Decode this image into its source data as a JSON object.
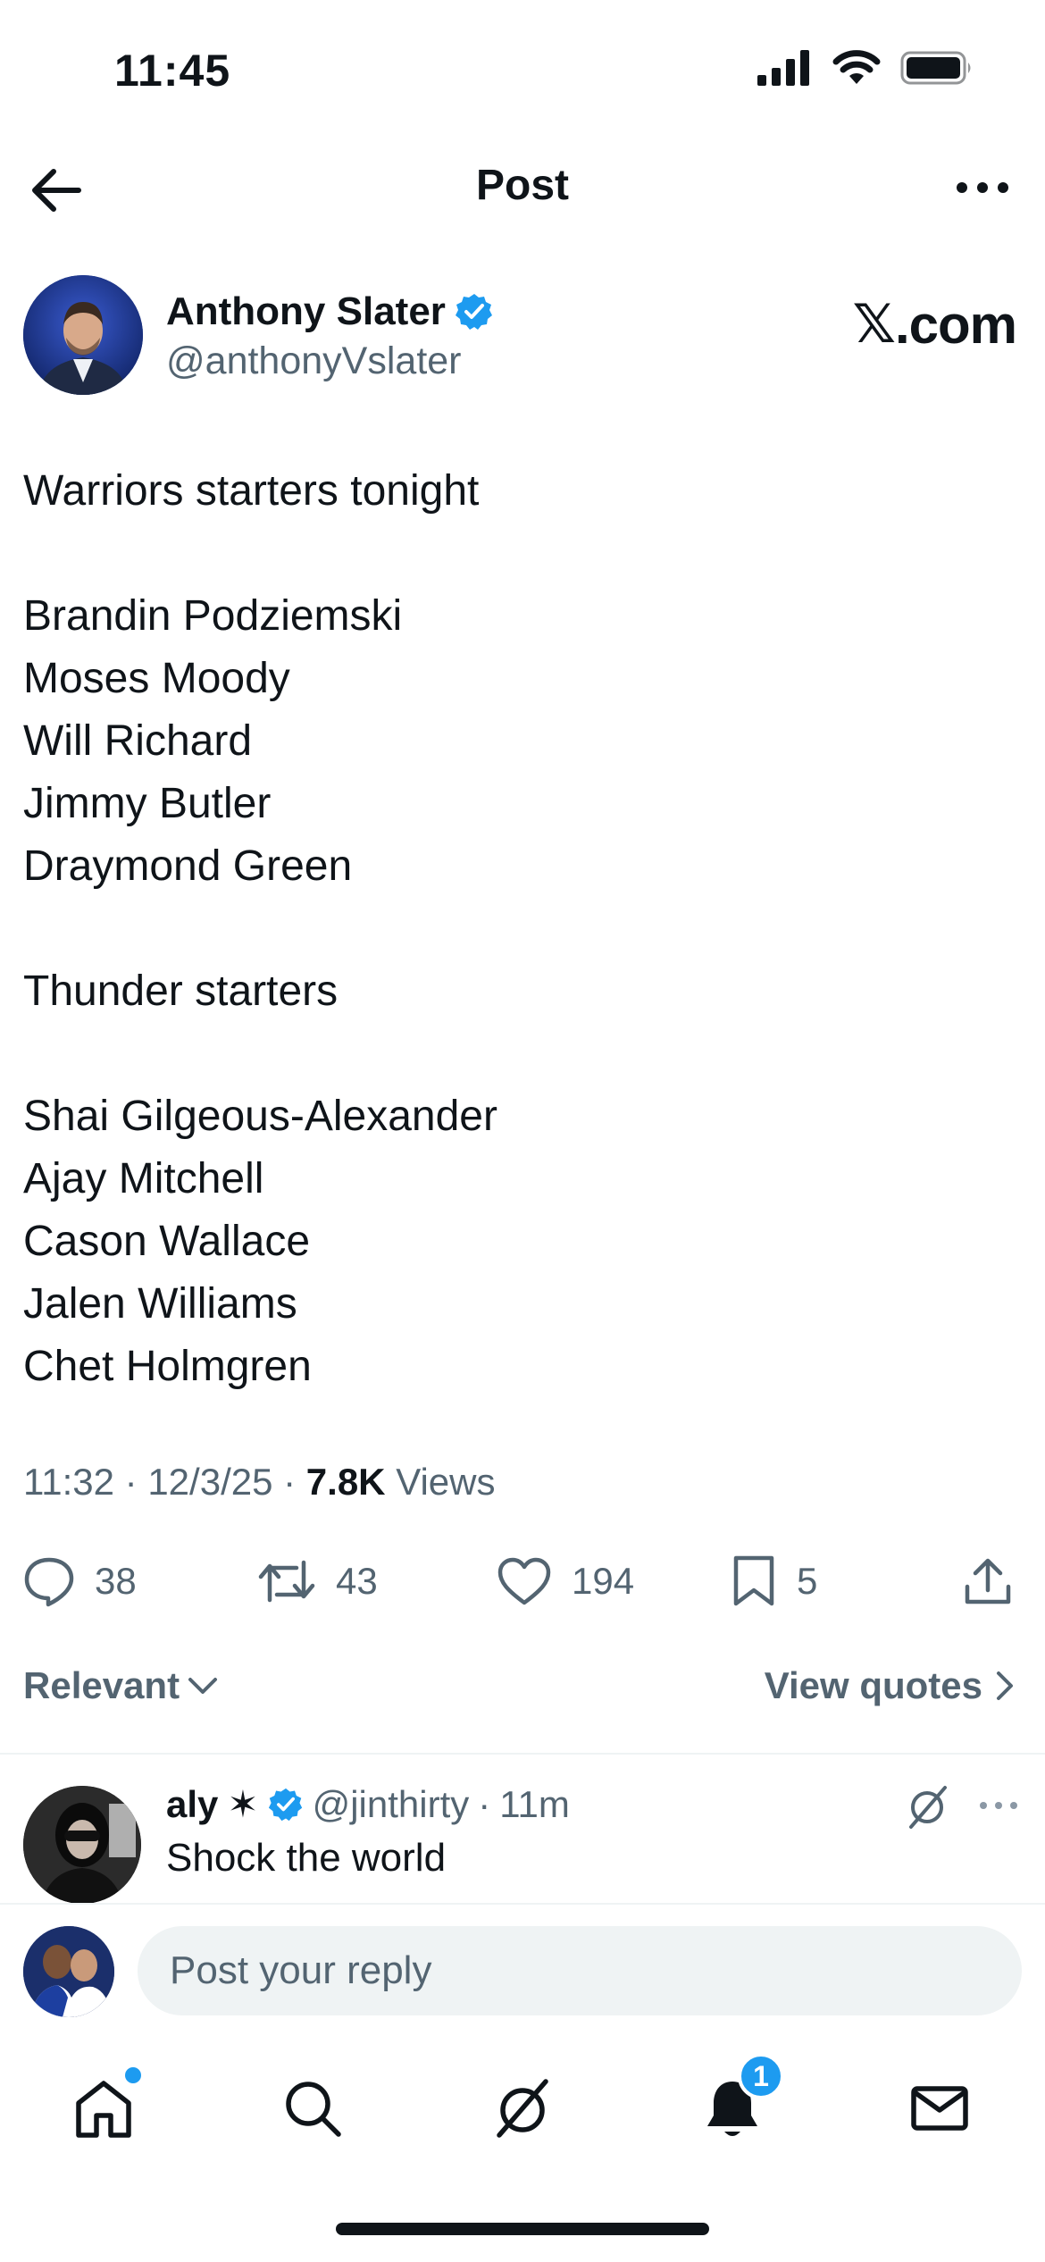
{
  "status_bar": {
    "time": "11:45"
  },
  "header": {
    "title": "Post"
  },
  "author": {
    "name": "Anthony Slater",
    "handle": "@anthonyVslater",
    "verified": true,
    "brand_label": ".com",
    "brand_glyph": "𝕏"
  },
  "tweet": {
    "lines": [
      "Warriors starters tonight",
      "",
      "Brandin Podziemski",
      "Moses Moody",
      "Will Richard",
      "Jimmy Butler",
      "Draymond Green",
      "",
      "Thunder starters",
      "",
      "Shai Gilgeous-Alexander",
      "Ajay Mitchell",
      "Cason Wallace",
      "Jalen Williams",
      "Chet Holmgren"
    ],
    "time": "11:32",
    "date": "12/3/25",
    "views_count": "7.8K",
    "views_label": "Views",
    "sep": " · "
  },
  "actions": {
    "replies": "38",
    "reposts": "43",
    "likes": "194",
    "bookmarks": "5"
  },
  "sort": {
    "label": "Relevant",
    "view_quotes": "View quotes"
  },
  "reply": {
    "name": "aly",
    "star": "✶",
    "handle": "@jinthirty",
    "sep": "·",
    "age": "11m",
    "text": "Shock the world"
  },
  "composer": {
    "placeholder": "Post your reply"
  },
  "tabbar": {
    "notifications_badge": "1"
  },
  "colors": {
    "accent": "#1d9bf0",
    "text": "#0f1419",
    "muted": "#536471"
  }
}
